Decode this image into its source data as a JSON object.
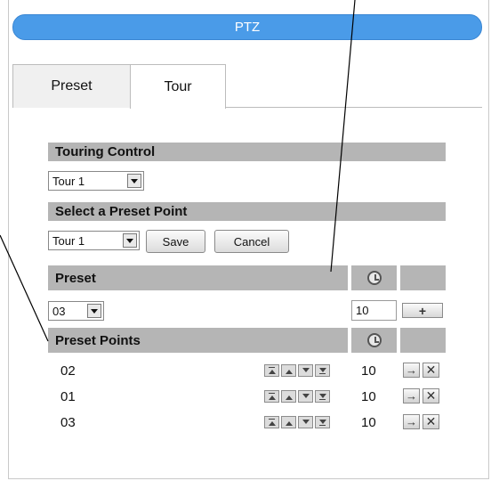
{
  "header": {
    "title": "PTZ"
  },
  "tabs": [
    {
      "label": "Preset"
    },
    {
      "label": "Tour"
    }
  ],
  "touring_control": {
    "heading": "Touring Control",
    "tour_select": "Tour 1"
  },
  "select_preset_point": {
    "heading": "Select a Preset Point",
    "tour_select": "Tour 1",
    "save_label": "Save",
    "cancel_label": "Cancel"
  },
  "preset": {
    "heading": "Preset",
    "preset_select": "03",
    "dwell_value": "10",
    "add_label": "+"
  },
  "preset_points": {
    "heading": "Preset Points",
    "rows": [
      {
        "name": "02",
        "dwell": "10"
      },
      {
        "name": "01",
        "dwell": "10"
      },
      {
        "name": "03",
        "dwell": "10"
      }
    ]
  },
  "colors": {
    "header_blue": "#4a9be8",
    "section_gray": "#b5b5b5"
  }
}
